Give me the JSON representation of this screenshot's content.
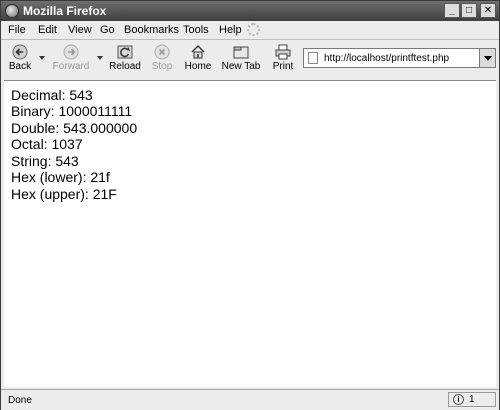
{
  "window": {
    "title": "Mozilla Firefox"
  },
  "menu": {
    "items": [
      {
        "label": "File"
      },
      {
        "label": "Edit"
      },
      {
        "label": "View"
      },
      {
        "label": "Go"
      },
      {
        "label": "Bookmarks"
      },
      {
        "label": "Tools"
      },
      {
        "label": "Help"
      }
    ]
  },
  "toolbar": {
    "back": "Back",
    "forward": "Forward",
    "reload": "Reload",
    "stop": "Stop",
    "home": "Home",
    "newtab": "New Tab",
    "print": "Print"
  },
  "address_bar": {
    "url": "http://localhost/printftest.php"
  },
  "content": {
    "lines": [
      "Decimal: 543",
      "Binary: 1000011111",
      "Double: 543.000000",
      "Octal: 1037",
      "String: 543",
      "Hex (lower): 21f",
      "Hex (upper): 21F"
    ]
  },
  "status": {
    "text": "Done",
    "info_count": "1"
  }
}
